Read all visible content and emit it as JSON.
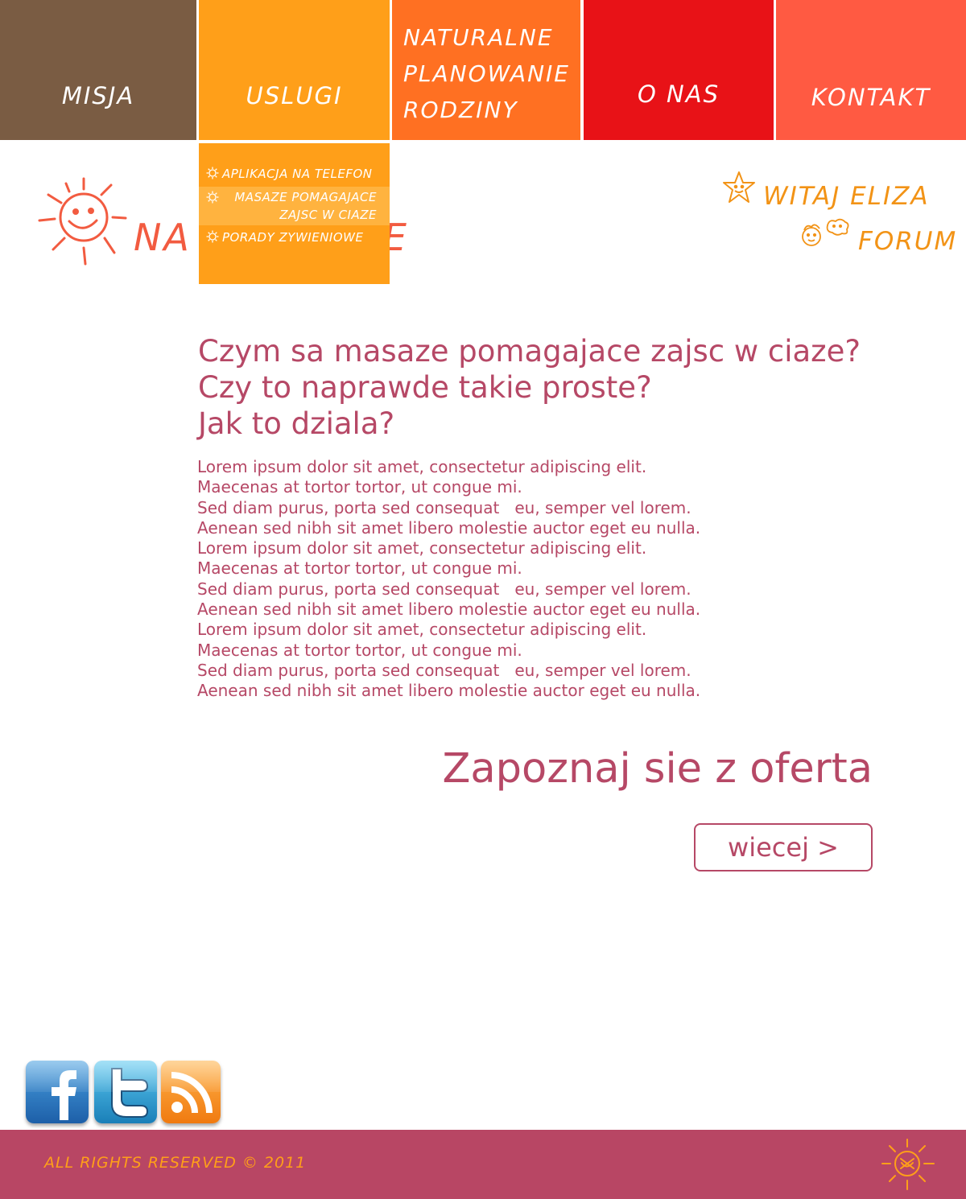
{
  "colors": {
    "misja": "#7a5c43",
    "uslugi": "#ff9f19",
    "npr": "#ff7022",
    "onas": "#e81217",
    "kontakt": "#ff5a42",
    "dropdown_bg": "#ff9f19",
    "dropdown_highlight": "#ffb33f",
    "logo": "#f25b40",
    "accent_orange": "#f29316",
    "text_rose": "#b64866",
    "footer_bg": "#b84664",
    "footer_text": "#ff9f19"
  },
  "nav": {
    "misja": "MISJA",
    "uslugi": "USLUGI",
    "npr_lines": [
      "NATURALNE",
      "PLANOWANIE",
      "RODZINY"
    ],
    "onas": "O NAS",
    "kontakt": "KONTAKT"
  },
  "dropdown": {
    "item1": "APLIKACJA NA TELEFON",
    "item2_line1": "MASAZE POMAGAJACE",
    "item2_line2": "ZAJSC W CIAZE",
    "item3": "PORADY ZYWIENIOWE"
  },
  "logo": {
    "text_visible": "NA",
    "text_tail": "E",
    "icon": "sun-icon"
  },
  "user": {
    "greeting": "WITAJ ELIZA",
    "forum": "FORUM",
    "greeting_icon": "star-icon",
    "forum_icon": "kids-icon"
  },
  "main": {
    "headline": [
      "Czym sa masaze pomagajace zajsc w ciaze?",
      "Czy to naprawde takie proste?",
      "Jak to dziala?"
    ],
    "body": [
      "Lorem ipsum dolor sit amet, consectetur adipiscing elit.",
      "Maecenas at tortor tortor, ut congue mi.",
      "Sed diam purus, porta sed consequat   eu, semper vel lorem.",
      "Aenean sed nibh sit amet libero molestie auctor eget eu nulla.",
      "Lorem ipsum dolor sit amet, consectetur adipiscing elit.",
      "Maecenas at tortor tortor, ut congue mi.",
      "Sed diam purus, porta sed consequat   eu, semper vel lorem.",
      "Aenean sed nibh sit amet libero molestie auctor eget eu nulla.",
      "Lorem ipsum dolor sit amet, consectetur adipiscing elit.",
      "Maecenas at tortor tortor, ut congue mi.",
      "Sed diam purus, porta sed consequat   eu, semper vel lorem.",
      "Aenean sed nibh sit amet libero molestie auctor eget eu nulla."
    ],
    "offer_title": "Zapoznaj sie z oferta",
    "more_button": "wiecej >"
  },
  "social": {
    "facebook": "facebook-icon",
    "twitter": "twitter-icon",
    "rss": "rss-icon"
  },
  "footer": {
    "copyright": "ALL RIGHTS RESERVED  ©  2011",
    "icon": "sun-icon"
  }
}
